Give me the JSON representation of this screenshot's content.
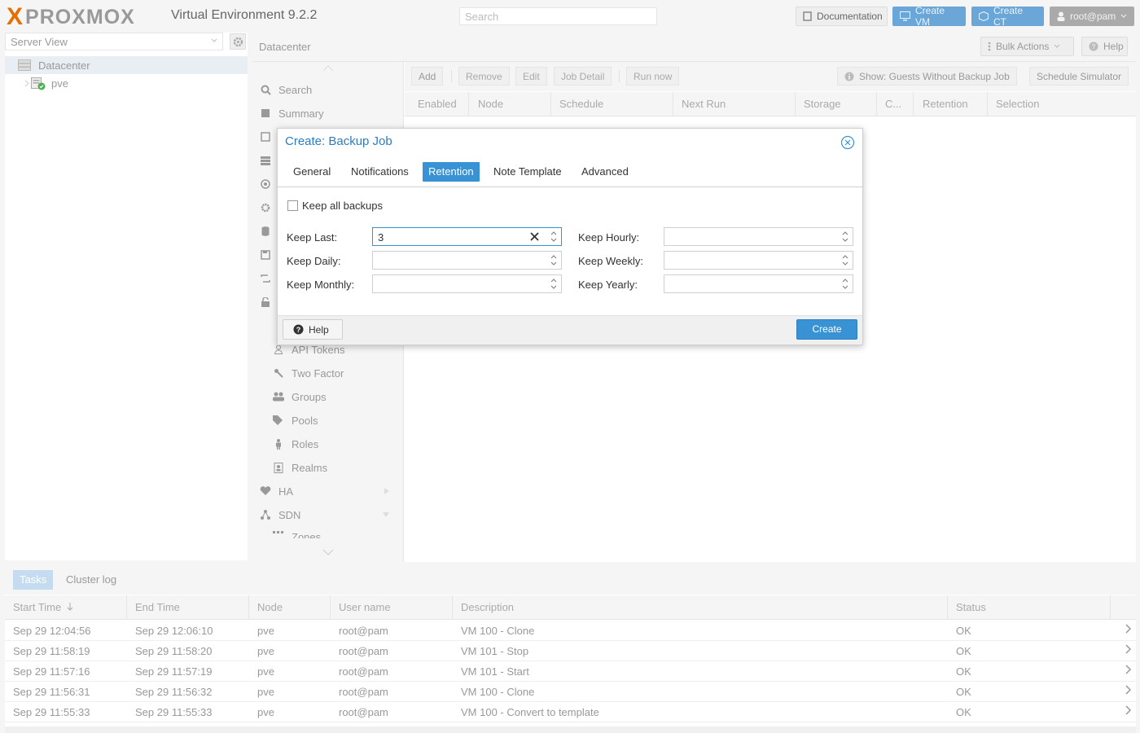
{
  "header": {
    "logo_text": "PROXMOX",
    "logo_x": "X",
    "version": "Virtual Environment 9.2.2",
    "search_placeholder": "Search",
    "documentation_label": "Documentation",
    "create_vm_label": "Create VM",
    "create_ct_label": "Create CT",
    "user_label": "root@pam"
  },
  "sidebar": {
    "view_select": "Server View",
    "tree": [
      {
        "label": "Datacenter"
      },
      {
        "label": "pve"
      }
    ]
  },
  "content": {
    "breadcrumb": "Datacenter",
    "bulk_actions_label": "Bulk Actions",
    "help_label": "Help",
    "nav_items": [
      {
        "label": "Search",
        "icon": "search-icon"
      },
      {
        "label": "Summary",
        "icon": "book-icon"
      },
      {
        "label": "API Tokens",
        "icon": "user-icon"
      },
      {
        "label": "Two Factor",
        "icon": "key-icon"
      },
      {
        "label": "Groups",
        "icon": "users-icon"
      },
      {
        "label": "Pools",
        "icon": "tags-icon"
      },
      {
        "label": "Roles",
        "icon": "male-icon"
      },
      {
        "label": "Realms",
        "icon": "address-book-icon"
      },
      {
        "label": "HA",
        "icon": "heartbeat-icon"
      },
      {
        "label": "SDN",
        "icon": "sdn-icon"
      },
      {
        "label": "Zones",
        "icon": "zones-icon"
      }
    ],
    "toolbar": {
      "add": "Add",
      "remove": "Remove",
      "edit": "Edit",
      "job_detail": "Job Detail",
      "run_now": "Run now",
      "show_guests": "Show: Guests Without Backup Job",
      "schedule_simulator": "Schedule Simulator"
    },
    "grid_columns": [
      "Enabled",
      "Node",
      "Schedule",
      "Next Run",
      "Storage",
      "C...",
      "Retention",
      "Selection"
    ]
  },
  "dialog": {
    "title": "Create: Backup Job",
    "tabs": [
      "General",
      "Notifications",
      "Retention",
      "Note Template",
      "Advanced"
    ],
    "active_tab": "Retention",
    "keep_all_label": "Keep all backups",
    "keep_all_checked": false,
    "fields": {
      "keep_last": {
        "label": "Keep Last:",
        "value": "3"
      },
      "keep_hourly": {
        "label": "Keep Hourly:",
        "value": ""
      },
      "keep_daily": {
        "label": "Keep Daily:",
        "value": ""
      },
      "keep_weekly": {
        "label": "Keep Weekly:",
        "value": ""
      },
      "keep_monthly": {
        "label": "Keep Monthly:",
        "value": ""
      },
      "keep_yearly": {
        "label": "Keep Yearly:",
        "value": ""
      }
    },
    "help_label": "Help",
    "create_label": "Create"
  },
  "tasks": {
    "tabs": [
      "Tasks",
      "Cluster log"
    ],
    "columns": [
      "Start Time",
      "End Time",
      "Node",
      "User name",
      "Description",
      "Status"
    ],
    "rows": [
      {
        "start": "Sep 29 12:04:56",
        "end": "Sep 29 12:06:10",
        "node": "pve",
        "user": "root@pam",
        "desc": "VM 100 - Clone",
        "status": "OK"
      },
      {
        "start": "Sep 29 11:58:19",
        "end": "Sep 29 11:58:20",
        "node": "pve",
        "user": "root@pam",
        "desc": "VM 101 - Stop",
        "status": "OK"
      },
      {
        "start": "Sep 29 11:57:16",
        "end": "Sep 29 11:57:19",
        "node": "pve",
        "user": "root@pam",
        "desc": "VM 101 - Start",
        "status": "OK"
      },
      {
        "start": "Sep 29 11:56:31",
        "end": "Sep 29 11:56:32",
        "node": "pve",
        "user": "root@pam",
        "desc": "VM 100 - Clone",
        "status": "OK"
      },
      {
        "start": "Sep 29 11:55:33",
        "end": "Sep 29 11:55:33",
        "node": "pve",
        "user": "root@pam",
        "desc": "VM 100 - Convert to template",
        "status": "OK"
      }
    ]
  },
  "colors": {
    "accent": "#3892d4",
    "brand_orange": "#e57000",
    "title_blue": "#2b7dc3"
  }
}
